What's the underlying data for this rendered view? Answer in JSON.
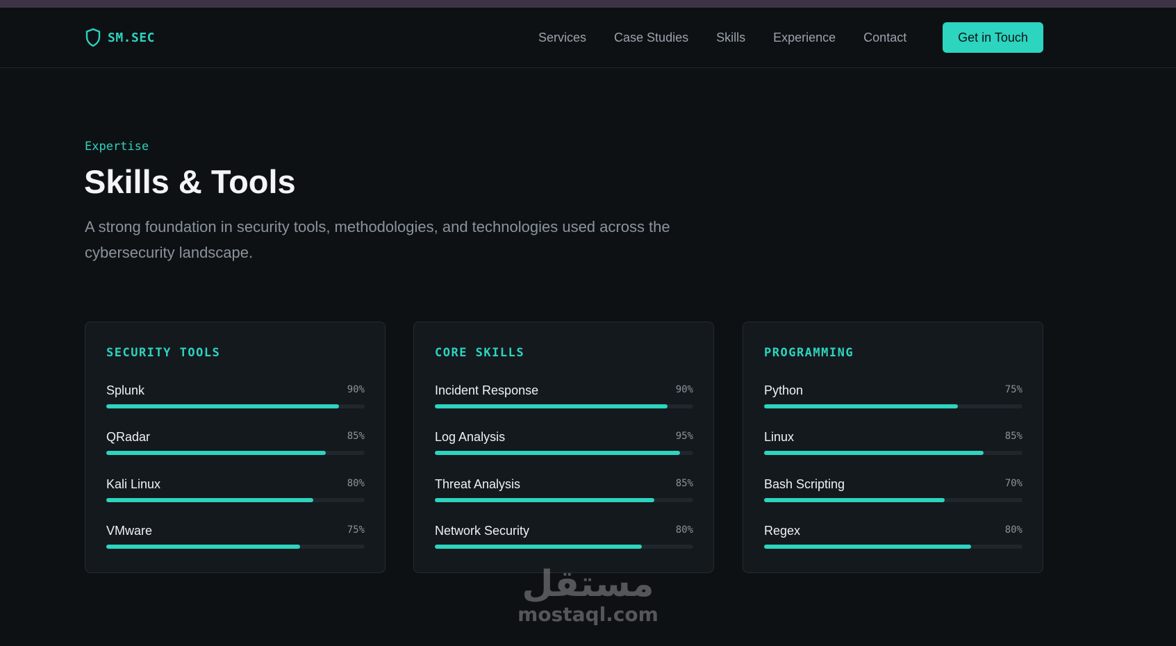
{
  "nav": {
    "brand": "SM.SEC",
    "brand_icon": "shield-icon",
    "links": [
      "Services",
      "Case Studies",
      "Skills",
      "Experience",
      "Contact"
    ],
    "cta": "Get in Touch"
  },
  "hero": {
    "eyebrow": "Expertise",
    "title": "Skills & Tools",
    "subtitle": "A strong foundation in security tools, methodologies, and technologies used across the cybersecurity landscape."
  },
  "cards": [
    {
      "title": "SECURITY TOOLS",
      "skills": [
        {
          "name": "Splunk",
          "pct": "90%",
          "level": 90
        },
        {
          "name": "QRadar",
          "pct": "85%",
          "level": 85
        },
        {
          "name": "Kali Linux",
          "pct": "80%",
          "level": 80
        },
        {
          "name": "VMware",
          "pct": "75%",
          "level": 75
        }
      ]
    },
    {
      "title": "CORE SKILLS",
      "skills": [
        {
          "name": "Incident Response",
          "pct": "90%",
          "level": 90
        },
        {
          "name": "Log Analysis",
          "pct": "95%",
          "level": 95
        },
        {
          "name": "Threat Analysis",
          "pct": "85%",
          "level": 85
        },
        {
          "name": "Network Security",
          "pct": "80%",
          "level": 80
        }
      ]
    },
    {
      "title": "PROGRAMMING",
      "skills": [
        {
          "name": "Python",
          "pct": "75%",
          "level": 75
        },
        {
          "name": "Linux",
          "pct": "85%",
          "level": 85
        },
        {
          "name": "Bash Scripting",
          "pct": "70%",
          "level": 70
        },
        {
          "name": "Regex",
          "pct": "80%",
          "level": 80
        }
      ]
    }
  ],
  "watermark": {
    "arabic": "مستقل",
    "latin": "mostaql.com"
  },
  "colors": {
    "accent": "#2dd4bf",
    "background": "#0e1114",
    "card": "#14191d"
  }
}
